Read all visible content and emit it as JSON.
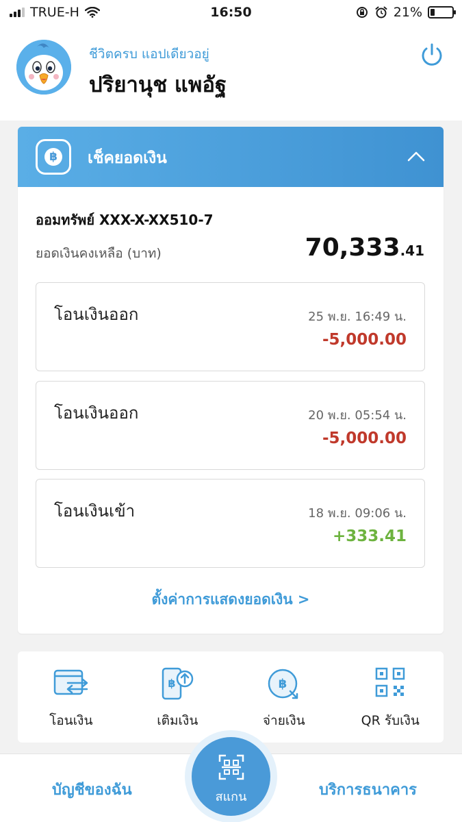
{
  "status_bar": {
    "carrier": "TRUE-H",
    "time": "16:50",
    "battery": "21%",
    "battery_level": 0.21
  },
  "header": {
    "greeting": "ชีวิตครบ แอปเดียวอยู่",
    "username": "ปริยานุช แพอัฐ"
  },
  "balance_card": {
    "title": "เช็คยอดเงิน",
    "account": "ออมทรัพย์ XXX-X-XX510-7",
    "balance_label": "ยอดเงินคงเหลือ (บาท)",
    "balance_main": "70,333",
    "balance_decimal": ".41",
    "transactions": [
      {
        "title": "โอนเงินออก",
        "date": "25 พ.ย. 16:49 น.",
        "amount": "-5,000.00"
      },
      {
        "title": "โอนเงินออก",
        "date": "20 พ.ย. 05:54 น.",
        "amount": "-5,000.00"
      },
      {
        "title": "โอนเงินเข้า",
        "date": "18 พ.ย. 09:06 น.",
        "amount": "+333.41"
      }
    ],
    "settings_link": "ตั้งค่าการแสดงยอดเงิน >"
  },
  "actions": [
    {
      "label": "โอนเงิน",
      "icon": "transfer-icon"
    },
    {
      "label": "เติมเงิน",
      "icon": "topup-icon"
    },
    {
      "label": "จ่ายเงิน",
      "icon": "pay-icon"
    },
    {
      "label": "QR รับเงิน",
      "icon": "qr-icon"
    }
  ],
  "bottom_nav": {
    "left": "บัญชีของฉัน",
    "center": "สแกน",
    "right": "บริการธนาคาร"
  },
  "colors": {
    "accent": "#3f9bd8",
    "negative": "#c0392b",
    "positive": "#6db33f",
    "header_blue": "#4a9ad8"
  }
}
